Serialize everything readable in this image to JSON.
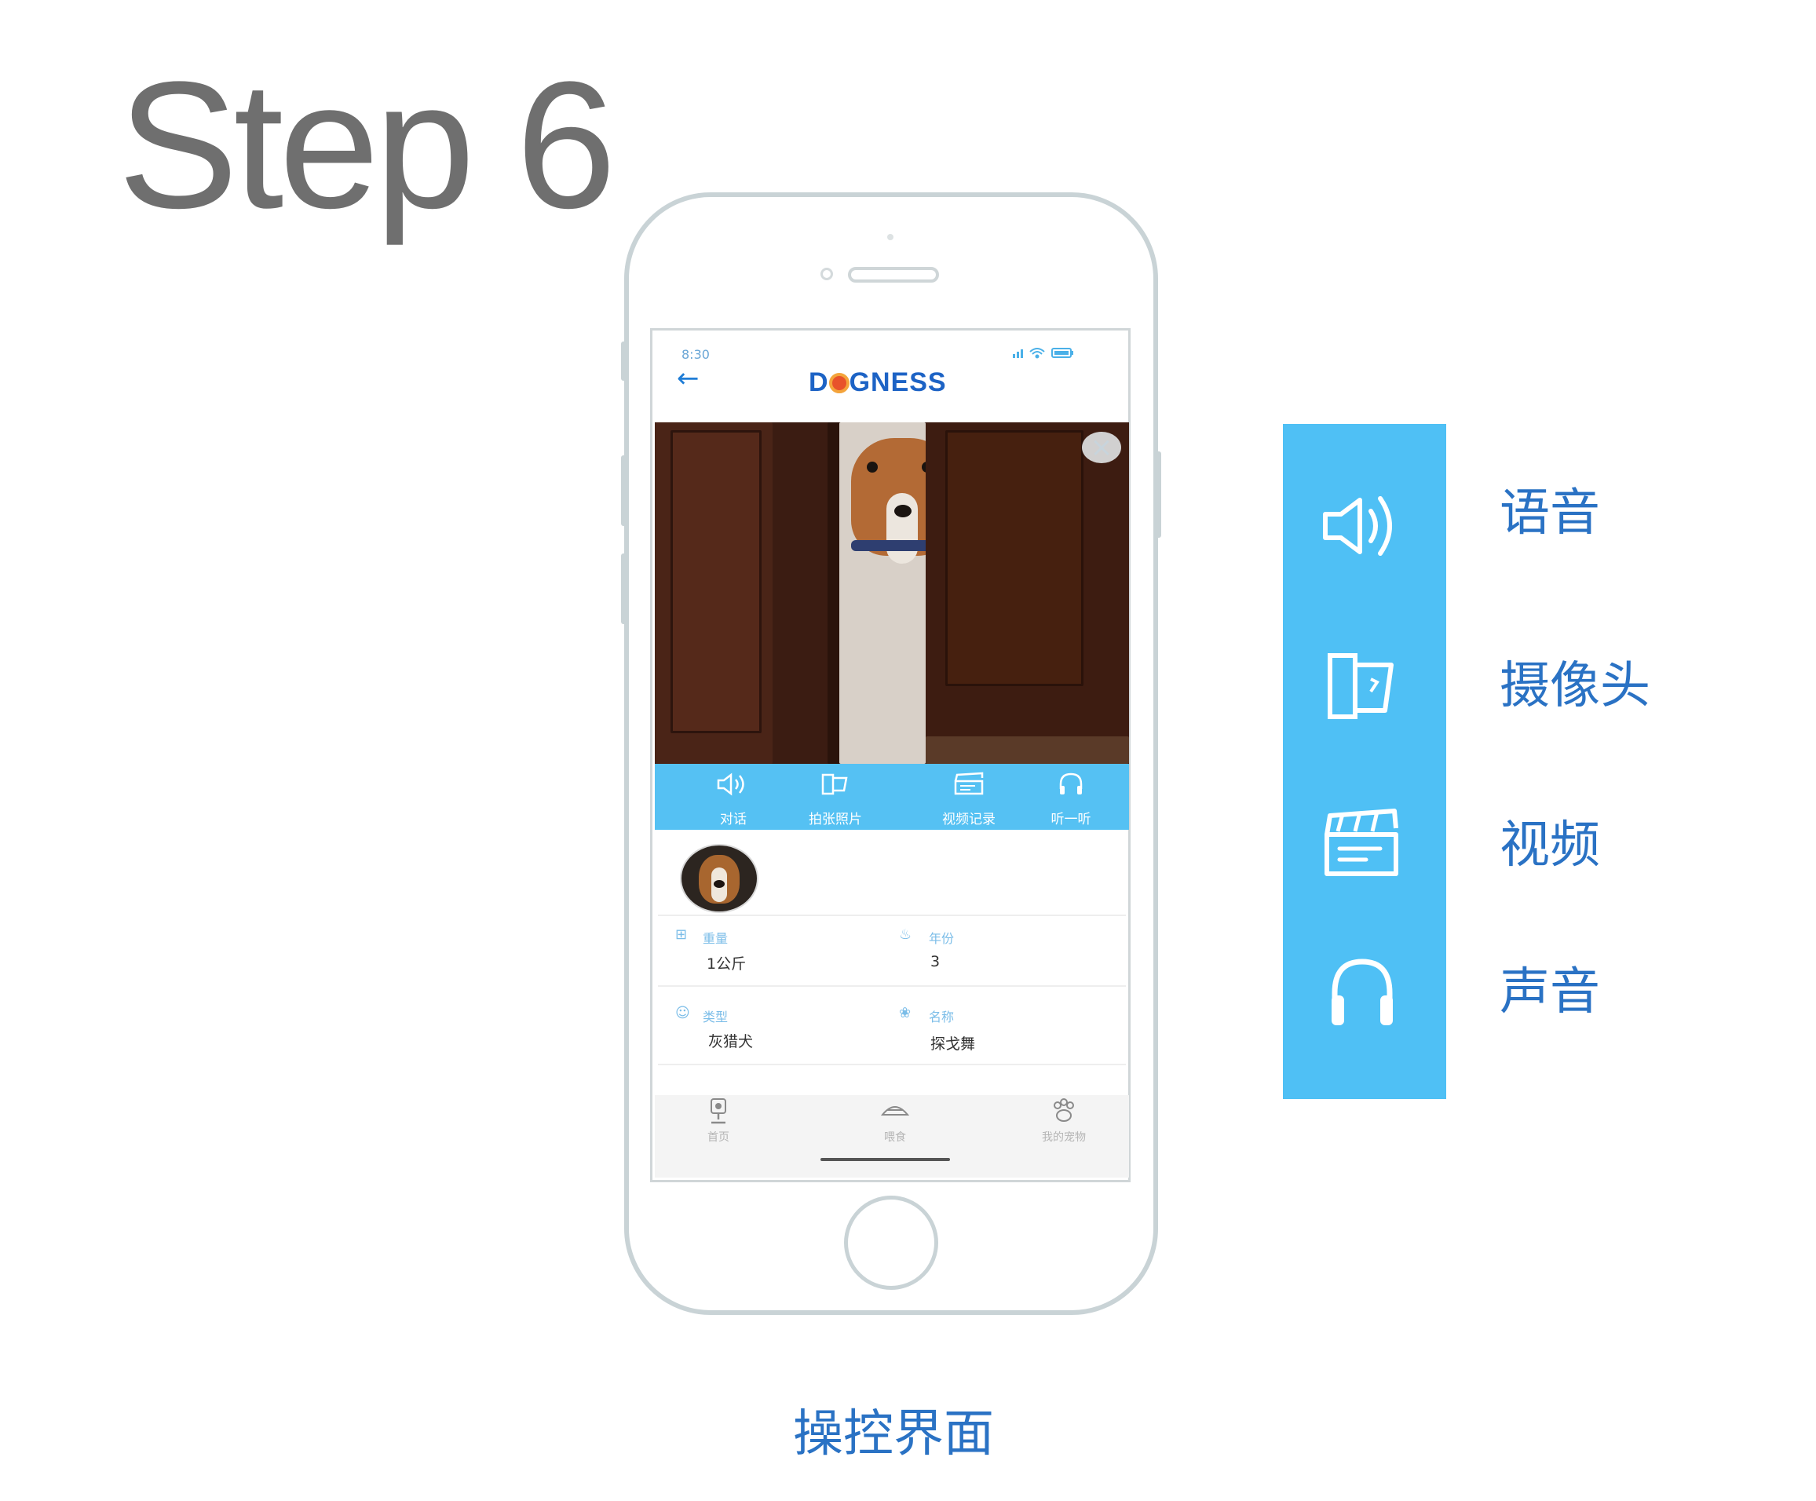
{
  "page": {
    "step_title": "Step 6",
    "caption": "操控界面"
  },
  "app": {
    "status_time": "8:30",
    "back_icon": "back-arrow-icon",
    "brand_prefix": "D",
    "brand_suffix": "GNESS",
    "toolbar": [
      {
        "id": "talk",
        "label": "对话",
        "icon": "speaker-icon"
      },
      {
        "id": "photo",
        "label": "拍张照片",
        "icon": "camera-icon"
      },
      {
        "id": "video",
        "label": "视频记录",
        "icon": "clapperboard-icon"
      },
      {
        "id": "listen",
        "label": "听一听",
        "icon": "headphones-icon"
      }
    ],
    "profile": {
      "weight_label": "重量",
      "weight_value": "1公斤",
      "age_label": "年份",
      "age_value": "3",
      "type_label": "类型",
      "type_value": "灰猎犬",
      "name_label": "名称",
      "name_value": "探戈舞"
    },
    "nav": [
      {
        "label": "首页",
        "icon": "camera-device-icon"
      },
      {
        "label": "喂食",
        "icon": "feeder-icon"
      },
      {
        "label": "我的宠物",
        "icon": "paw-icon"
      }
    ]
  },
  "legend": [
    {
      "label": "语音",
      "icon": "speaker-icon"
    },
    {
      "label": "摄像头",
      "icon": "camera-icon"
    },
    {
      "label": "视频",
      "icon": "clapperboard-icon"
    },
    {
      "label": "声音",
      "icon": "headphones-icon"
    }
  ],
  "colors": {
    "accent": "#4fc0f5",
    "text_blue": "#2a72c4",
    "brand": "#1d63c5",
    "brand_o": "#e8522b",
    "frame": "#c9d3d6"
  }
}
